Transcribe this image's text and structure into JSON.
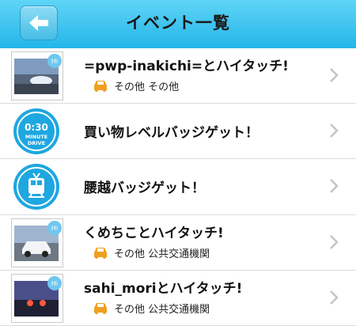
{
  "header": {
    "title": "イベント一覧",
    "back_icon": "arrow-left-icon"
  },
  "events": [
    {
      "title": "=pwp-inakichi=とハイタッチ!",
      "subtitle": "その他 その他",
      "type": "hi-touch"
    },
    {
      "title": "買い物レベルバッジゲット！",
      "type": "badge",
      "badge_line1": "0:30",
      "badge_line2": "MINUTE",
      "badge_line3": "DRIVE"
    },
    {
      "title": "腰越バッジゲット！",
      "type": "badge-train"
    },
    {
      "title": "くめちことハイタッチ!",
      "subtitle": "その他 公共交通機関",
      "type": "hi-touch"
    },
    {
      "title": "sahi_moriとハイタッチ!",
      "subtitle": "その他 公共交通機関",
      "type": "hi-touch"
    }
  ],
  "colors": {
    "header": "#23b6e8",
    "badge": "#1ea7e0",
    "car": "#f0a020"
  }
}
